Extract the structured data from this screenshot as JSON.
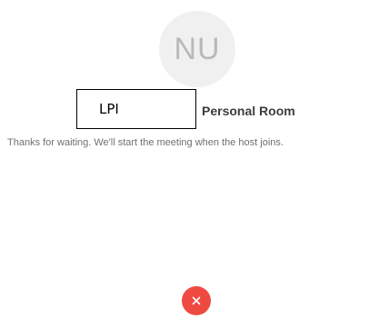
{
  "avatar": {
    "initials": "NU",
    "background": "#f0f0f0",
    "text_color": "#b9b9b9"
  },
  "meeting": {
    "host_name": "LPI",
    "room_label": "Personal Room",
    "waiting_message": "Thanks for waiting. We'll start the meeting when the host joins."
  },
  "controls": {
    "leave_icon": "close-icon",
    "leave_color": "#ef4a42"
  }
}
